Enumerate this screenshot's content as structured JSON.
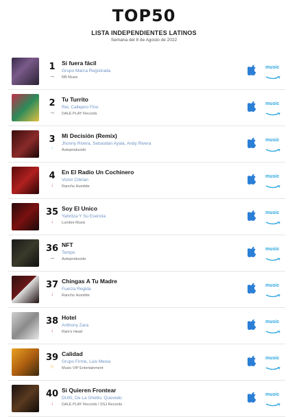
{
  "header": {
    "title": "TOP50",
    "subtitle": "LISTA INDEPENDIENTES LATINOS",
    "week": "Semana del 8 de Agosto de 2022"
  },
  "colors": {
    "accent_blue": "#6d93c4",
    "apple_blue": "#2b7fd6",
    "amazon_blue": "#2ea6e0",
    "down_pink": "#d65ba0",
    "up_cyan": "#8fd6e8",
    "new_star": "#f0a830"
  },
  "icons": {
    "apple": "apple-music-icon",
    "amazon": "amazon-music-icon"
  },
  "entries": [
    {
      "rank": "1",
      "trend": "same",
      "song": "Si fuera fácil",
      "artist": "Grupo Marca Registrada",
      "label": "RB Music",
      "amazon_text": "music"
    },
    {
      "rank": "2",
      "trend": "same",
      "song": "Tu Turrito",
      "artist": "Rei, Callejero Fino",
      "label": "DALE PLAY Records",
      "amazon_text": "music"
    },
    {
      "rank": "3",
      "trend": "up",
      "song": "Mi Decisión (Remix)",
      "artist": "Jhonny Rivera, Sebastián Ayala, Andy Rivera",
      "label": "Autoproducido",
      "amazon_text": "music"
    },
    {
      "rank": "4",
      "trend": "down",
      "song": "En El Radio Un Cochinero",
      "artist": "Victor Cibrian",
      "label": "Rancho Humilde",
      "amazon_text": "music"
    },
    {
      "rank": "35",
      "trend": "down",
      "song": "Soy El Unico",
      "artist": "Yahritza Y Su Esencia",
      "label": "Lumbre Music",
      "amazon_text": "music"
    },
    {
      "rank": "36",
      "trend": "same",
      "song": "NFT",
      "artist": "Tempo",
      "label": "Autoproducido",
      "amazon_text": "music"
    },
    {
      "rank": "37",
      "trend": "down",
      "song": "Chingas A Tu Madre",
      "artist": "Fuerza Regida",
      "label": "Rancho Humilde",
      "amazon_text": "music"
    },
    {
      "rank": "38",
      "trend": "down",
      "song": "Hotel",
      "artist": "Anthony Zara",
      "label": "Ram's Head",
      "amazon_text": "music"
    },
    {
      "rank": "39",
      "trend": "new",
      "song": "Calidad",
      "artist": "Grupo Firme, Luis Mexia",
      "label": "Music VIP Entertainment",
      "amazon_text": "music"
    },
    {
      "rank": "40",
      "trend": "down",
      "song": "Si Quieren Frontear",
      "artist": "DUKI, De La Ghetto, Quevedo",
      "label": "DALE PLAY Records / SSJ Records",
      "amazon_text": "music"
    }
  ]
}
